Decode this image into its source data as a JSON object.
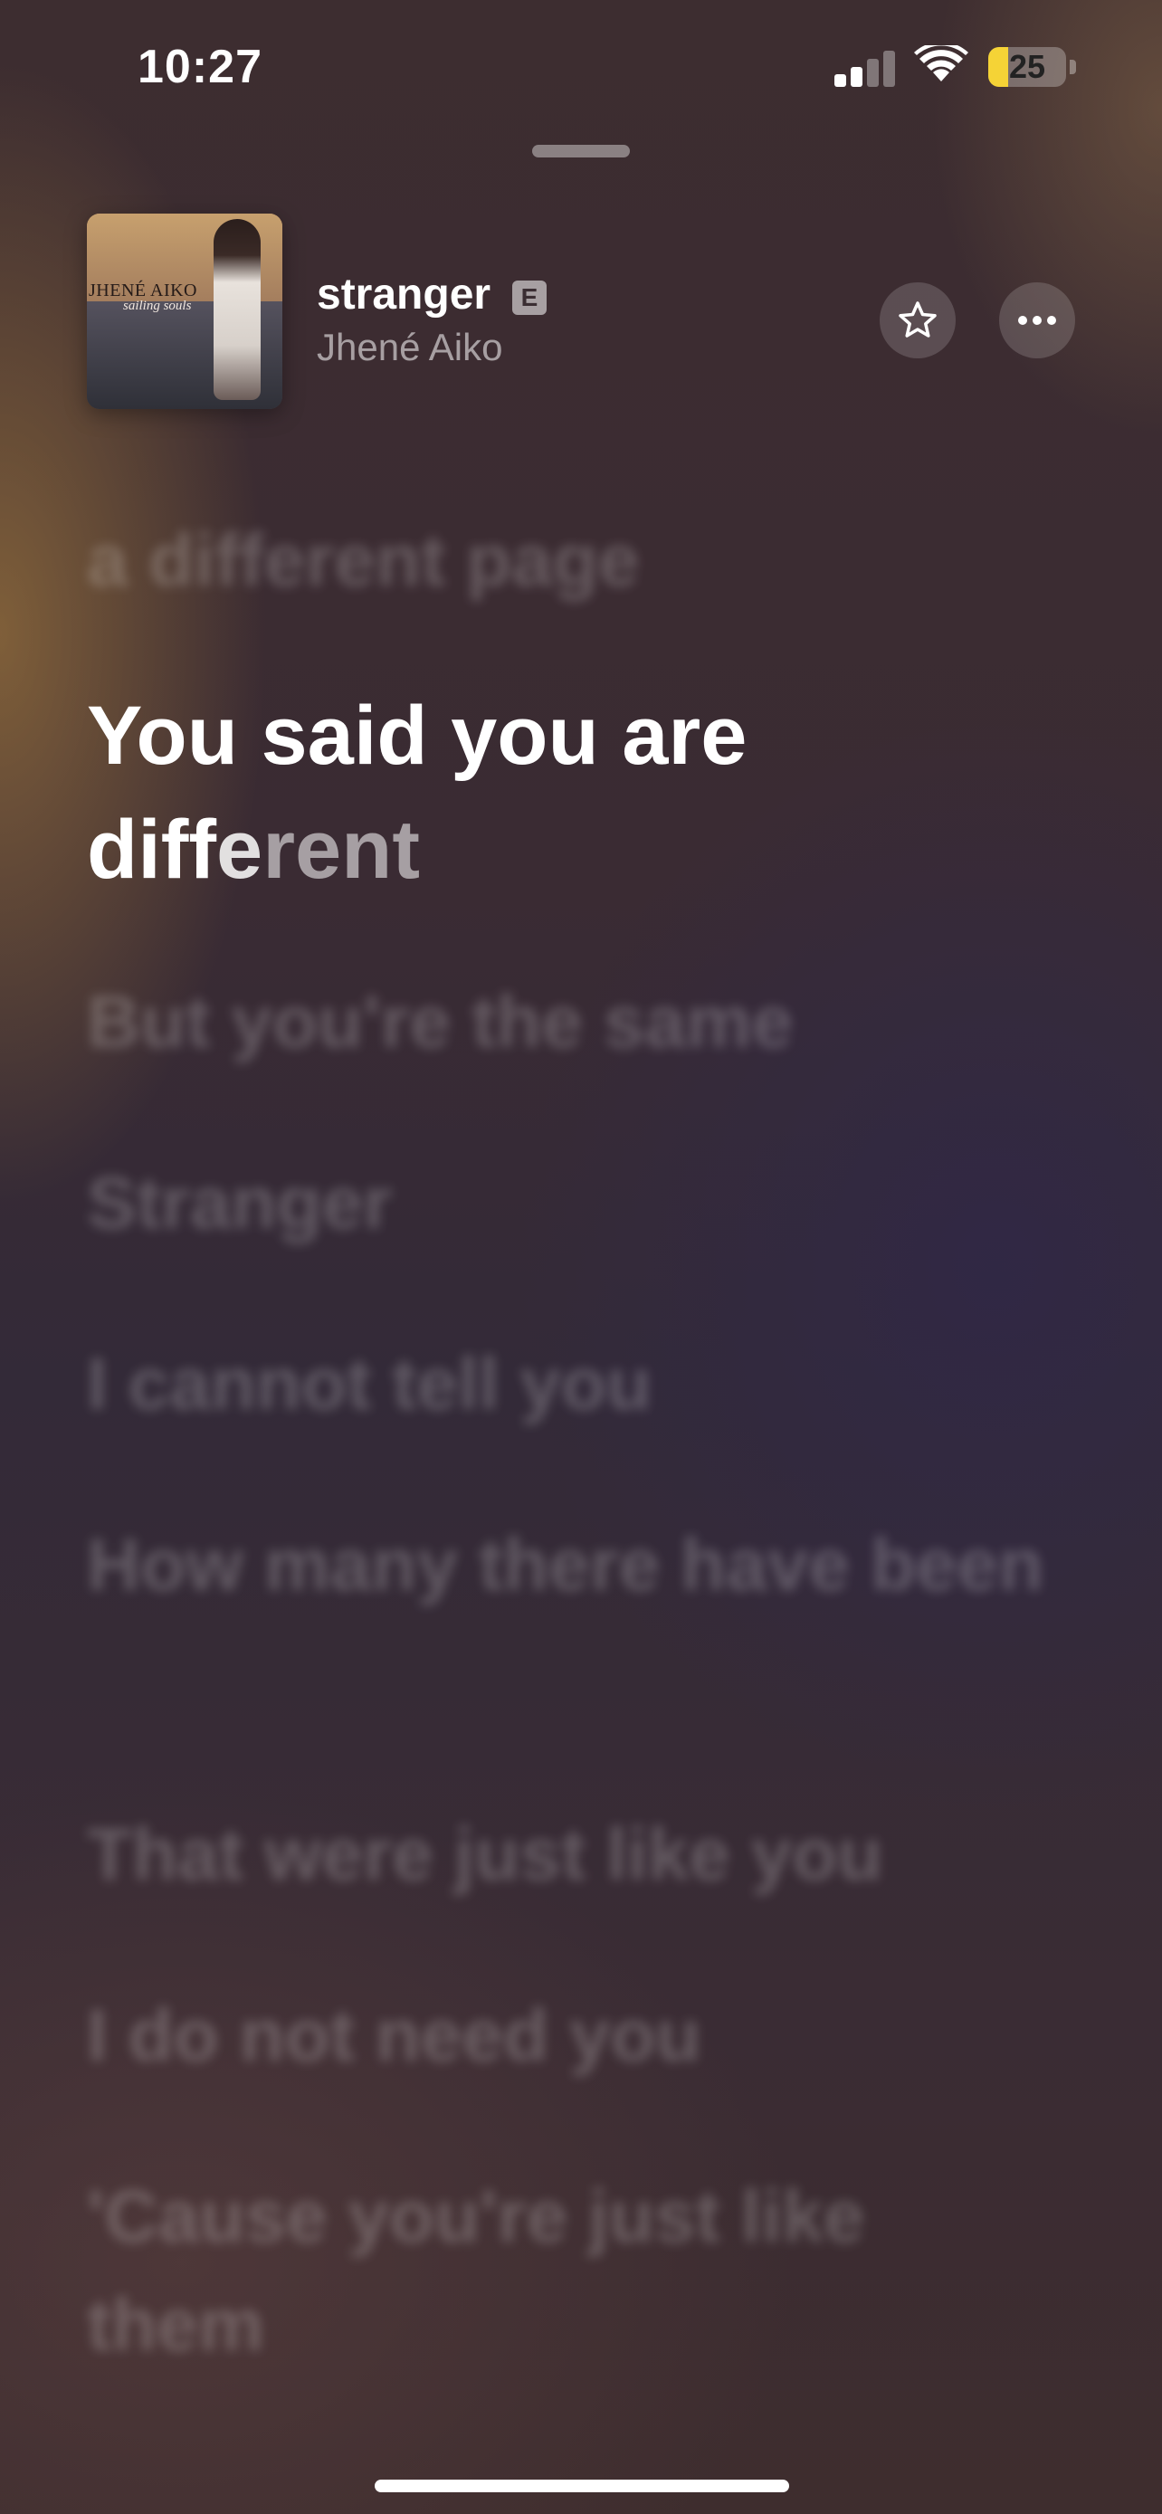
{
  "status_bar": {
    "time": "10:27",
    "battery_percent": "25",
    "battery_level": 0.25,
    "battery_color": "#f5d336",
    "signal_bars_active": 2,
    "icons": [
      "cellular-signal-icon",
      "wifi-icon",
      "battery-icon"
    ]
  },
  "now_playing": {
    "title": "stranger",
    "explicit_label": "E",
    "artist": "Jhené Aiko",
    "artwork": {
      "text_line1": "JHENÉ AIKO",
      "text_line2": "sailing souls"
    },
    "favorite_icon": "star-icon",
    "more_icon": "ellipsis-icon"
  },
  "lyrics": {
    "previous": "a different page",
    "current": {
      "line1": "You said you are",
      "line2_sung": "diff",
      "line2_singing": "e",
      "line2_unsung": "rent"
    },
    "upcoming": [
      "But you're the same",
      "Stranger",
      "I cannot tell you",
      "How many there have been",
      "That were just like you",
      "I do not need you",
      "'Cause you're just like them"
    ]
  }
}
